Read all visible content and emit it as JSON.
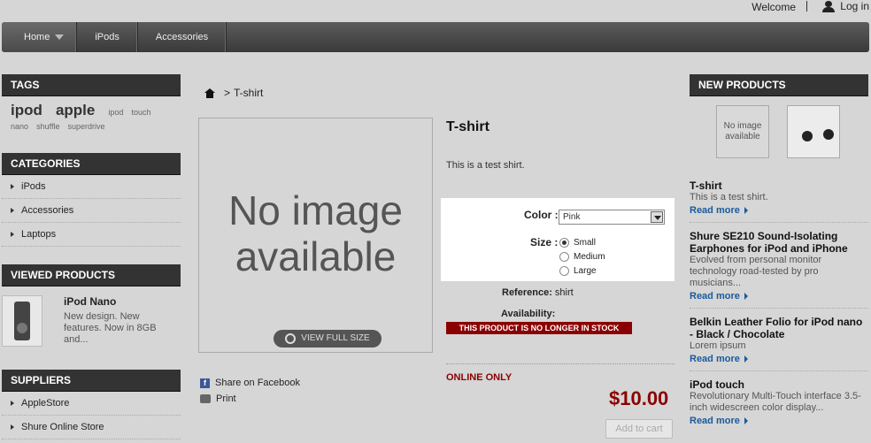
{
  "header": {
    "welcome": "Welcome",
    "login": "Log in"
  },
  "nav": {
    "items": [
      "Home",
      "iPods",
      "Accessories"
    ]
  },
  "tags": {
    "title": "TAGS",
    "big": [
      "ipod",
      "apple"
    ],
    "small_row1": [
      "ipod",
      "touch"
    ],
    "small_row2": [
      "nano",
      "shuffle",
      "superdrive"
    ]
  },
  "categories": {
    "title": "CATEGORIES",
    "items": [
      "iPods",
      "Accessories",
      "Laptops"
    ]
  },
  "viewed": {
    "title": "VIEWED PRODUCTS",
    "name": "iPod Nano",
    "desc": "New design. New features. Now in 8GB and..."
  },
  "suppliers": {
    "title": "SUPPLIERS",
    "items": [
      "AppleStore",
      "Shure Online Store"
    ]
  },
  "breadcrumb": {
    "current": "T-shirt",
    "separator": ">"
  },
  "product": {
    "noimage_line1": "No image",
    "noimage_line2": "available",
    "view_full": "VIEW FULL SIZE",
    "share_facebook": "Share on Facebook",
    "print": "Print",
    "title": "T-shirt",
    "desc": "This is a test shirt.",
    "color_label": "Color :",
    "color_value": "Pink",
    "size_label": "Size :",
    "sizes": [
      "Small",
      "Medium",
      "Large"
    ],
    "selected_size": "Small",
    "reference_label": "Reference:",
    "reference_value": "shirt",
    "availability_label": "Availability:",
    "stock_badge": "THIS PRODUCT IS NO LONGER IN STOCK",
    "online_only": "ONLINE ONLY",
    "price": "$10.00",
    "add_to_cart": "Add to cart"
  },
  "new_products": {
    "title": "NEW PRODUCTS",
    "thumb_noimage": "No image available",
    "read_more": "Read more",
    "items": [
      {
        "name": "T-shirt",
        "desc": "This is a test shirt."
      },
      {
        "name": "Shure SE210 Sound-Isolating Earphones for iPod and iPhone",
        "desc": "Evolved from personal monitor technology road-tested by pro musicians..."
      },
      {
        "name": "Belkin Leather Folio for iPod nano - Black / Chocolate",
        "desc": "Lorem ipsum"
      },
      {
        "name": "iPod touch",
        "desc": "Revolutionary Multi-Touch interface 3.5-inch widescreen color display..."
      }
    ]
  },
  "colors": {
    "accent_red": "#8b0000",
    "link_blue": "#1a5a9c",
    "block_header": "#333333"
  }
}
